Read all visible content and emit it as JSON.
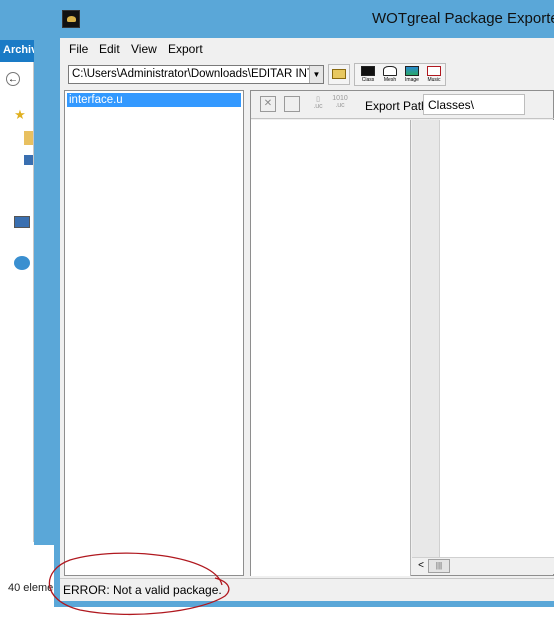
{
  "background_window": {
    "ribbon_tab": "Archiv",
    "status_text": "40 eleme"
  },
  "window": {
    "title": "WOTgreal Package Exporte",
    "menu": [
      "File",
      "Edit",
      "View",
      "Export"
    ],
    "toolbar": {
      "path_value": "C:\\Users\\Administrator\\Downloads\\EDITAR INT",
      "export_buttons": [
        "Class",
        "Mesh",
        "Image",
        "Music"
      ]
    },
    "file_list": {
      "items": [
        "interface.u"
      ],
      "selected": "interface.u"
    },
    "right_pane": {
      "export_path_label": "Export Path:",
      "export_path_value": "Classes\\"
    },
    "status": {
      "text": "ERROR: Not a valid package."
    }
  },
  "colors": {
    "titlebar": "#5aa7d8",
    "selection": "#3399ff",
    "annotation": "#b0181f"
  },
  "icons": {
    "app": "wotgreal-app-icon",
    "open": "open-folder-icon",
    "export_class": "export-class-icon",
    "export_mesh": "export-mesh-icon",
    "export_image": "export-image-icon",
    "export_music": "export-music-icon"
  }
}
